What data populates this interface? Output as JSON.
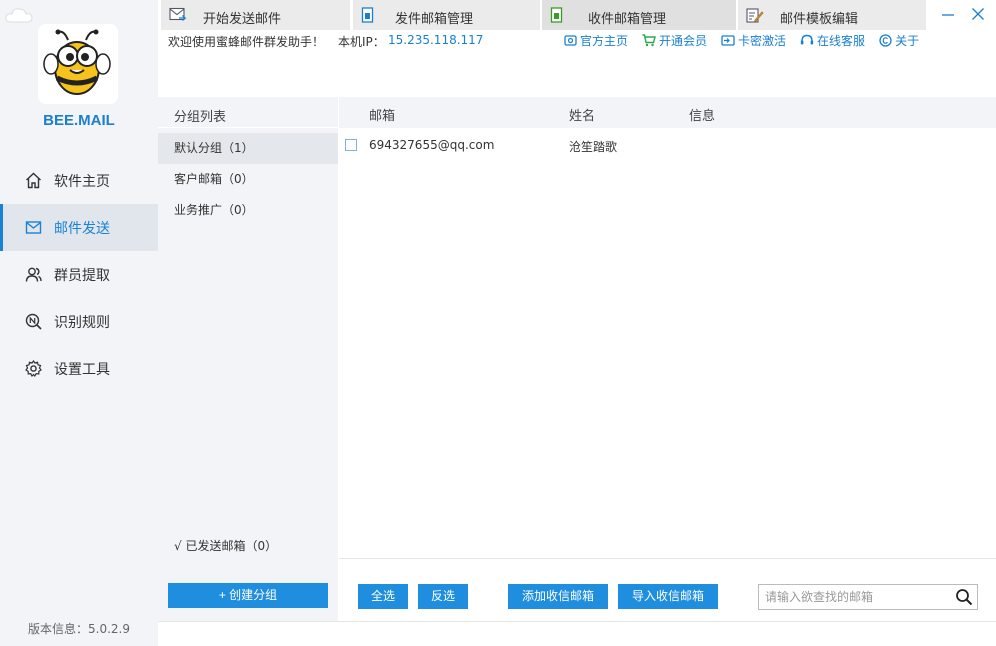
{
  "brand": {
    "name": "BEE.MAIL"
  },
  "sidebar": {
    "items": [
      {
        "label": "软件主页",
        "icon": "home-icon"
      },
      {
        "label": "邮件发送",
        "icon": "mail-icon",
        "active": true
      },
      {
        "label": "群员提取",
        "icon": "users-icon"
      },
      {
        "label": "识别规则",
        "icon": "rule-icon"
      },
      {
        "label": "设置工具",
        "icon": "gear-icon"
      }
    ],
    "version_label": "版本信息：",
    "version_value": "5.0.2.9"
  },
  "topbar": {
    "welcome": "欢迎使用蜜蜂邮件群发助手！",
    "ip_label": "本机IP：",
    "ip_value": "15.235.118.117",
    "links": [
      {
        "label": "官方主页",
        "icon": "home-page-icon"
      },
      {
        "label": "开通会员",
        "icon": "cart-icon"
      },
      {
        "label": "卡密激活",
        "icon": "card-icon"
      },
      {
        "label": "在线客服",
        "icon": "chat-icon"
      },
      {
        "label": "关于",
        "icon": "copyright-icon"
      }
    ]
  },
  "tabs": [
    {
      "label": "开始发送邮件",
      "icon": "send-mail-icon"
    },
    {
      "label": "发件邮箱管理",
      "icon": "outbox-icon"
    },
    {
      "label": "收件邮箱管理",
      "icon": "inbox-icon",
      "active": true
    },
    {
      "label": "邮件模板编辑",
      "icon": "edit-template-icon"
    }
  ],
  "groups": {
    "header": "分组列表",
    "items": [
      {
        "label": "默认分组（1）",
        "active": true
      },
      {
        "label": "客户邮箱（0）"
      },
      {
        "label": "业务推广（0）"
      }
    ],
    "sent": "√ 已发送邮箱（0）",
    "create_button": "+  创建分组"
  },
  "list": {
    "columns": [
      "邮箱",
      "姓名",
      "信息"
    ],
    "rows": [
      {
        "email": "694327655@qq.com",
        "name": "沧笙踏歌",
        "info": ""
      }
    ]
  },
  "actions": {
    "select_all": "全选",
    "invert": "反选",
    "add": "添加收信邮箱",
    "import": "导入收信邮箱",
    "search_placeholder": "请输入欲查找的邮箱"
  },
  "colors": {
    "accent": "#1f8ede",
    "link": "#1a7fd0",
    "sidebar_bg": "#f2f4f7"
  }
}
